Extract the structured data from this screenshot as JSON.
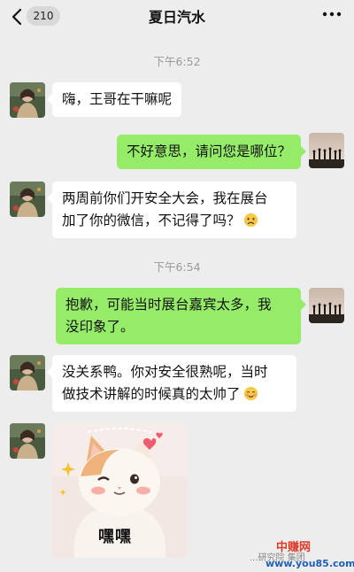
{
  "header": {
    "unread_count": "210",
    "title": "夏日汽水"
  },
  "timestamps": [
    "下午6:52",
    "下午6:54"
  ],
  "messages": [
    {
      "side": "left",
      "text": "嗨，王哥在干嘛呢"
    },
    {
      "side": "right",
      "text": "不好意思，请问您是哪位？"
    },
    {
      "side": "left",
      "line1": "两周前你们开安全大会，我在展台",
      "line2": "加了你的微信，不记得了吗？",
      "emoji": "sad-face-emoji"
    },
    {
      "side": "right",
      "line1": "抱歉，可能当时展台嘉宾太多，我",
      "line2": "没印象了。"
    },
    {
      "side": "left",
      "line1": "没关系鸭。你对安全很熟呢，当时",
      "line2": "做技术讲解的时候真的太帅了",
      "emoji": "blush-face-emoji"
    }
  ],
  "sticker": {
    "label": "嘿嘿"
  },
  "watermark": {
    "logo_text": "中赚网",
    "group_text": "...研究院 集团",
    "url": "www.you85.com"
  },
  "colors": {
    "background": "#ededed",
    "sent_bubble": "#95ec69",
    "received_bubble": "#ffffff"
  }
}
